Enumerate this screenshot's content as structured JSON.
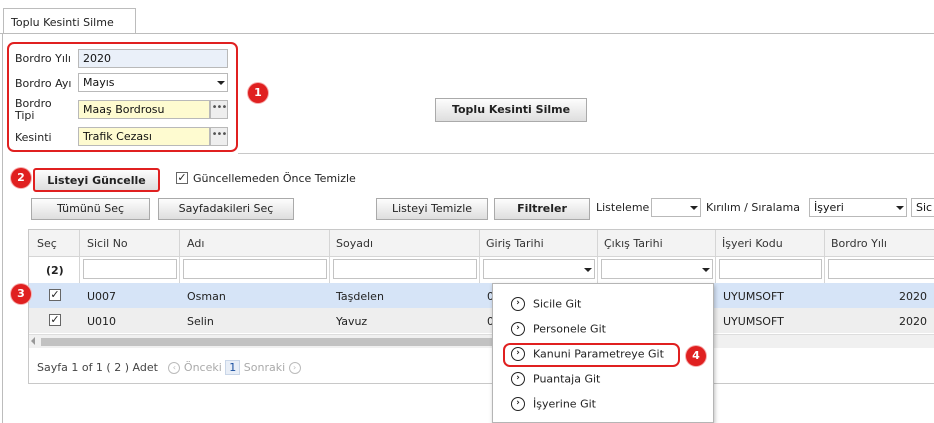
{
  "tab": {
    "label": "Toplu Kesinti Silme"
  },
  "form": {
    "year_label": "Bordro Yılı",
    "year_value": "2020",
    "month_label": "Bordro Ayı",
    "month_value": "Mayıs",
    "type_label": "Bordro Tipi",
    "type_value": "Maaş Bordrosu",
    "deduction_label": "Kesinti",
    "deduction_value": "Trafik Cezası",
    "ellipsis": "•••"
  },
  "badges": {
    "b1": "1",
    "b2": "2",
    "b3": "3",
    "b4": "4"
  },
  "actions": {
    "bulk_delete": "Toplu Kesinti Silme"
  },
  "toolbar": {
    "refresh": "Listeyi Güncelle",
    "clear_before_label": "Güncellemeden Önce Temizle",
    "select_all": "Tümünü Seç",
    "select_page": "Sayfadakileri Seç",
    "clear_list": "Listeyi Temizle",
    "filters": "Filtreler",
    "listing_label": "Listeleme",
    "listing_value": "",
    "breakdown_label": "Kırılım / Sıralama",
    "breakdown_value": "İşyeri",
    "extra_label": "Sic"
  },
  "grid": {
    "columns": [
      "Seç",
      "Sicil No",
      "Adı",
      "Soyadı",
      "Giriş Tarihi",
      "Çıkış Tarihi",
      "İşyeri Kodu",
      "Bordro Yılı"
    ],
    "selected_count": "(2)",
    "rows": [
      {
        "checked": true,
        "sicil": "U007",
        "ad": "Osman",
        "soyad": "Taşdelen",
        "giris": "0",
        "isyeri": "UYUMSOFT",
        "yil": "2020"
      },
      {
        "checked": true,
        "sicil": "U010",
        "ad": "Selin",
        "soyad": "Yavuz",
        "giris": "0",
        "isyeri": "UYUMSOFT",
        "yil": "2020"
      }
    ],
    "check_mark": "✓"
  },
  "pager": {
    "summary": "Sayfa 1 of 1 ( 2 ) Adet",
    "prev": "Önceki",
    "page": "1",
    "next": "Sonraki"
  },
  "context_menu": {
    "items": [
      "Sicile Git",
      "Personele Git",
      "Kanuni Parametreye Git",
      "Puantaja Git",
      "İşyerine Git"
    ],
    "highlighted_index": 2
  },
  "colors": {
    "accent_red": "#e02020",
    "selected_row": "#d6e4f7",
    "field_yellow": "#fefbd0"
  }
}
